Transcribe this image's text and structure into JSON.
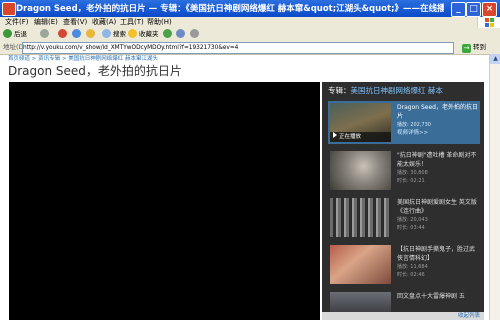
{
  "window": {
    "title": "Dragon Seed，老外拍的抗日片 — 专辑：《美国抗日神剧网络爆红 赫本窜&quot;江湖头&quot;》——在线播放—优酷网，视频高清在线观看 - M...",
    "minimize": "_",
    "maximize": "□",
    "close": "×"
  },
  "menu": [
    "文件(F)",
    "编辑(E)",
    "查看(V)",
    "收藏(A)",
    "工具(T)",
    "帮助(H)"
  ],
  "toolbar": {
    "back": "后退",
    "search": "搜索",
    "favorites": "收藏夹"
  },
  "address": {
    "label": "地址(D)",
    "url": "http://v.youku.com/v_show/id_XMTYwODcyMDOy.html?f=19321730&ev=4",
    "go": "转到"
  },
  "breadcrumb": "首页频道 > 资讯专辑 > 美国抗日神剧网络爆红 赫本窜江湖头",
  "page_title": "Dragon Seed，老外拍的抗日片",
  "sidebar": {
    "header_prefix": "专辑：",
    "header_title": "美国抗日神剧网络爆红",
    "header_name": "赫本",
    "items": [
      {
        "title": "Dragon Seed，老外拍的抗日片",
        "meta": "播放: 202,730",
        "link": "视频详情>>",
        "badge": "正在播放"
      },
      {
        "title": "\"抗日神剧\"遭吐槽 革命剧对不能太娱乐！",
        "meta": "播放: 30,808",
        "link": "时长: 02:21"
      },
      {
        "title": "美国抗日神剧爱剧女生 英文版《连行曲》",
        "meta": "播放: 20,043",
        "link": "时长: 03:44"
      },
      {
        "title": "【抗日神剧手撕鬼子，胜过武侠言情科幻】",
        "meta": "播放: 11,684",
        "link": "时长: 02:46"
      },
      {
        "title": "回文盘点十大雷爆神剧 五",
        "meta": "",
        "link": ""
      }
    ],
    "more": "收起列表"
  }
}
